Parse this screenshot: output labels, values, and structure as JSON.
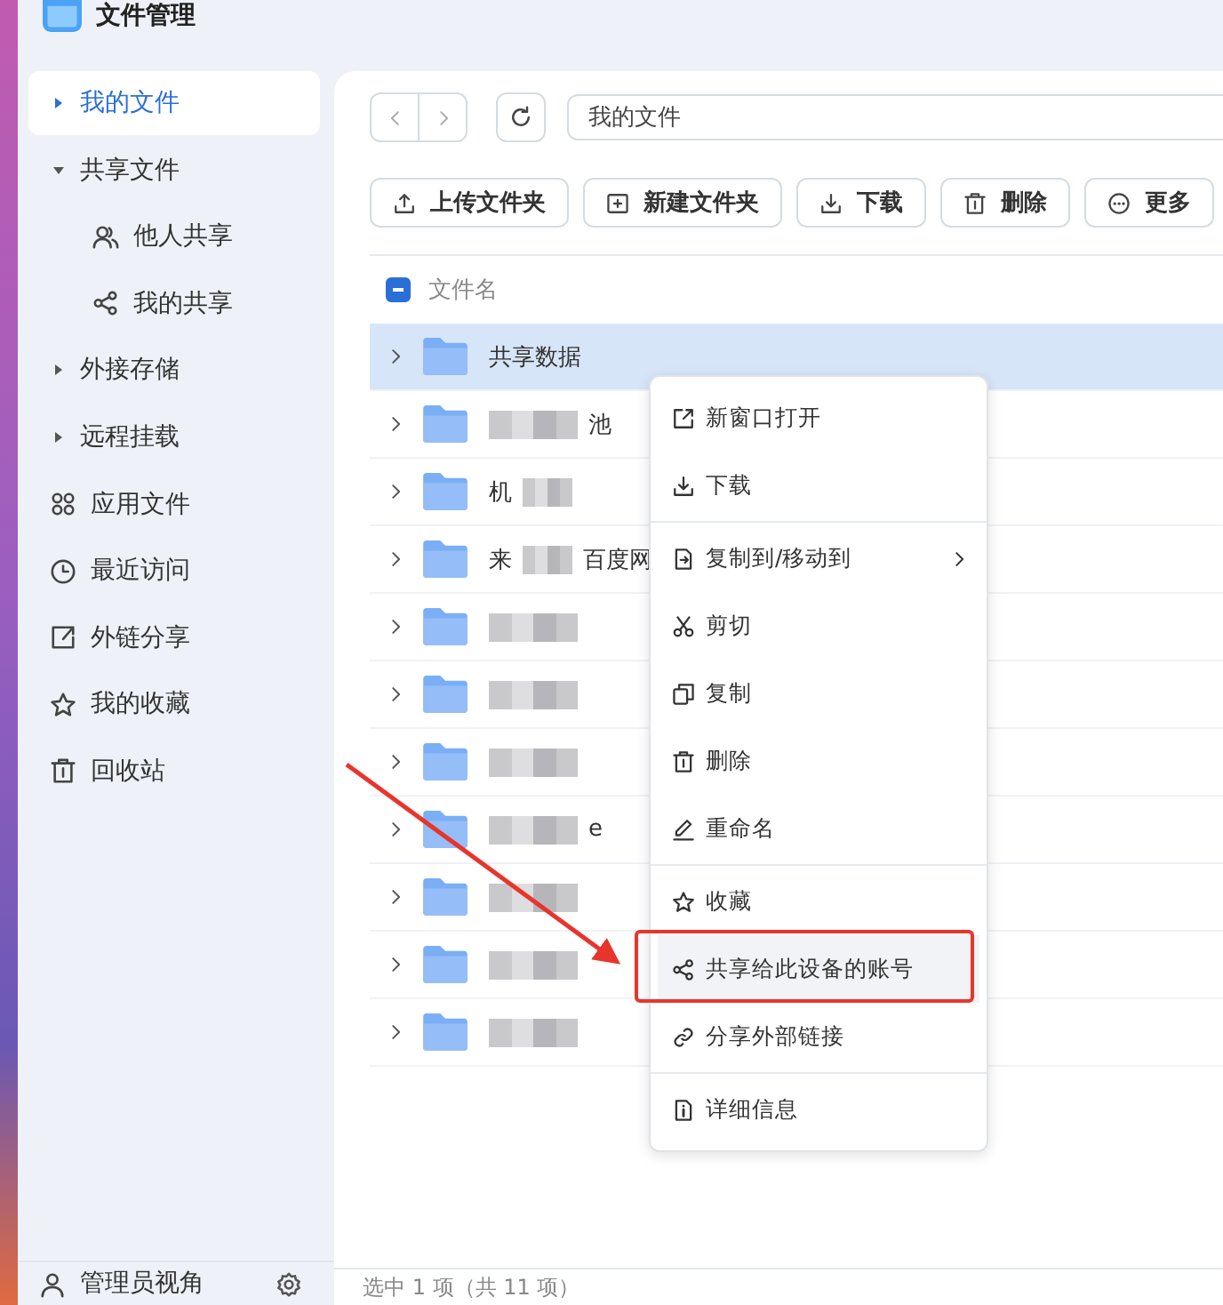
{
  "window": {
    "title": "文件管理"
  },
  "sidebar": {
    "items": [
      {
        "label": "我的文件",
        "kind": "expandable",
        "expanded": false,
        "selected": true
      },
      {
        "label": "共享文件",
        "kind": "expandable",
        "expanded": true,
        "selected": false,
        "children": [
          {
            "label": "他人共享",
            "selected": false
          },
          {
            "label": "我的共享",
            "selected": false
          }
        ]
      },
      {
        "label": "外接存储",
        "kind": "expandable",
        "expanded": false,
        "selected": false
      },
      {
        "label": "远程挂载",
        "kind": "expandable",
        "expanded": false,
        "selected": false
      },
      {
        "label": "应用文件",
        "kind": "link",
        "selected": false
      },
      {
        "label": "最近访问",
        "kind": "link",
        "selected": false
      },
      {
        "label": "外链分享",
        "kind": "link",
        "selected": false
      },
      {
        "label": "我的收藏",
        "kind": "link",
        "selected": false
      },
      {
        "label": "回收站",
        "kind": "link",
        "selected": false
      }
    ],
    "footer": {
      "label": "管理员视角"
    }
  },
  "path_field": {
    "value": "我的文件"
  },
  "actions": [
    {
      "label": "上传文件夹"
    },
    {
      "label": "新建文件夹"
    },
    {
      "label": "下载"
    },
    {
      "label": "删除"
    },
    {
      "label": "更多"
    }
  ],
  "table": {
    "columns": [
      "文件名"
    ],
    "select_all": {
      "indeterminate": true
    },
    "rows": [
      {
        "selected": true,
        "name": [
          {
            "kind": "text",
            "text": "共享数据"
          }
        ]
      },
      {
        "selected": false,
        "name": [
          {
            "kind": "blur"
          },
          {
            "kind": "text",
            "text": "池"
          }
        ]
      },
      {
        "selected": false,
        "name": [
          {
            "kind": "text",
            "text": "机"
          },
          {
            "kind": "blur"
          }
        ]
      },
      {
        "selected": false,
        "name": [
          {
            "kind": "text",
            "text": "来"
          },
          {
            "kind": "blur"
          },
          {
            "kind": "text",
            "text": "百度网"
          }
        ]
      },
      {
        "selected": false,
        "name": [
          {
            "kind": "blur"
          }
        ]
      },
      {
        "selected": false,
        "name": [
          {
            "kind": "blur"
          }
        ]
      },
      {
        "selected": false,
        "name": [
          {
            "kind": "blur"
          }
        ]
      },
      {
        "selected": false,
        "name": [
          {
            "kind": "blur"
          },
          {
            "kind": "text",
            "text": "e"
          }
        ]
      },
      {
        "selected": false,
        "name": [
          {
            "kind": "blur"
          }
        ]
      },
      {
        "selected": false,
        "name": [
          {
            "kind": "blur"
          }
        ]
      },
      {
        "selected": false,
        "name": [
          {
            "kind": "blur"
          }
        ]
      }
    ]
  },
  "context_menu": {
    "groups": [
      [
        {
          "label": "新窗口打开",
          "submenu": false,
          "highlighted": false
        },
        {
          "label": "下载",
          "submenu": false,
          "highlighted": false
        }
      ],
      [
        {
          "label": "复制到/移动到",
          "submenu": true,
          "highlighted": false
        },
        {
          "label": "剪切",
          "submenu": false,
          "highlighted": false
        },
        {
          "label": "复制",
          "submenu": false,
          "highlighted": false
        },
        {
          "label": "删除",
          "submenu": false,
          "highlighted": false
        },
        {
          "label": "重命名",
          "submenu": false,
          "highlighted": false
        }
      ],
      [
        {
          "label": "收藏",
          "submenu": false,
          "highlighted": false
        },
        {
          "label": "共享给此设备的账号",
          "submenu": false,
          "highlighted": true
        },
        {
          "label": "分享外部链接",
          "submenu": false,
          "highlighted": false
        }
      ],
      [
        {
          "label": "详细信息",
          "submenu": false,
          "highlighted": false
        }
      ]
    ]
  },
  "status_bar": {
    "text": "选中 1 项（共 11 项）"
  }
}
